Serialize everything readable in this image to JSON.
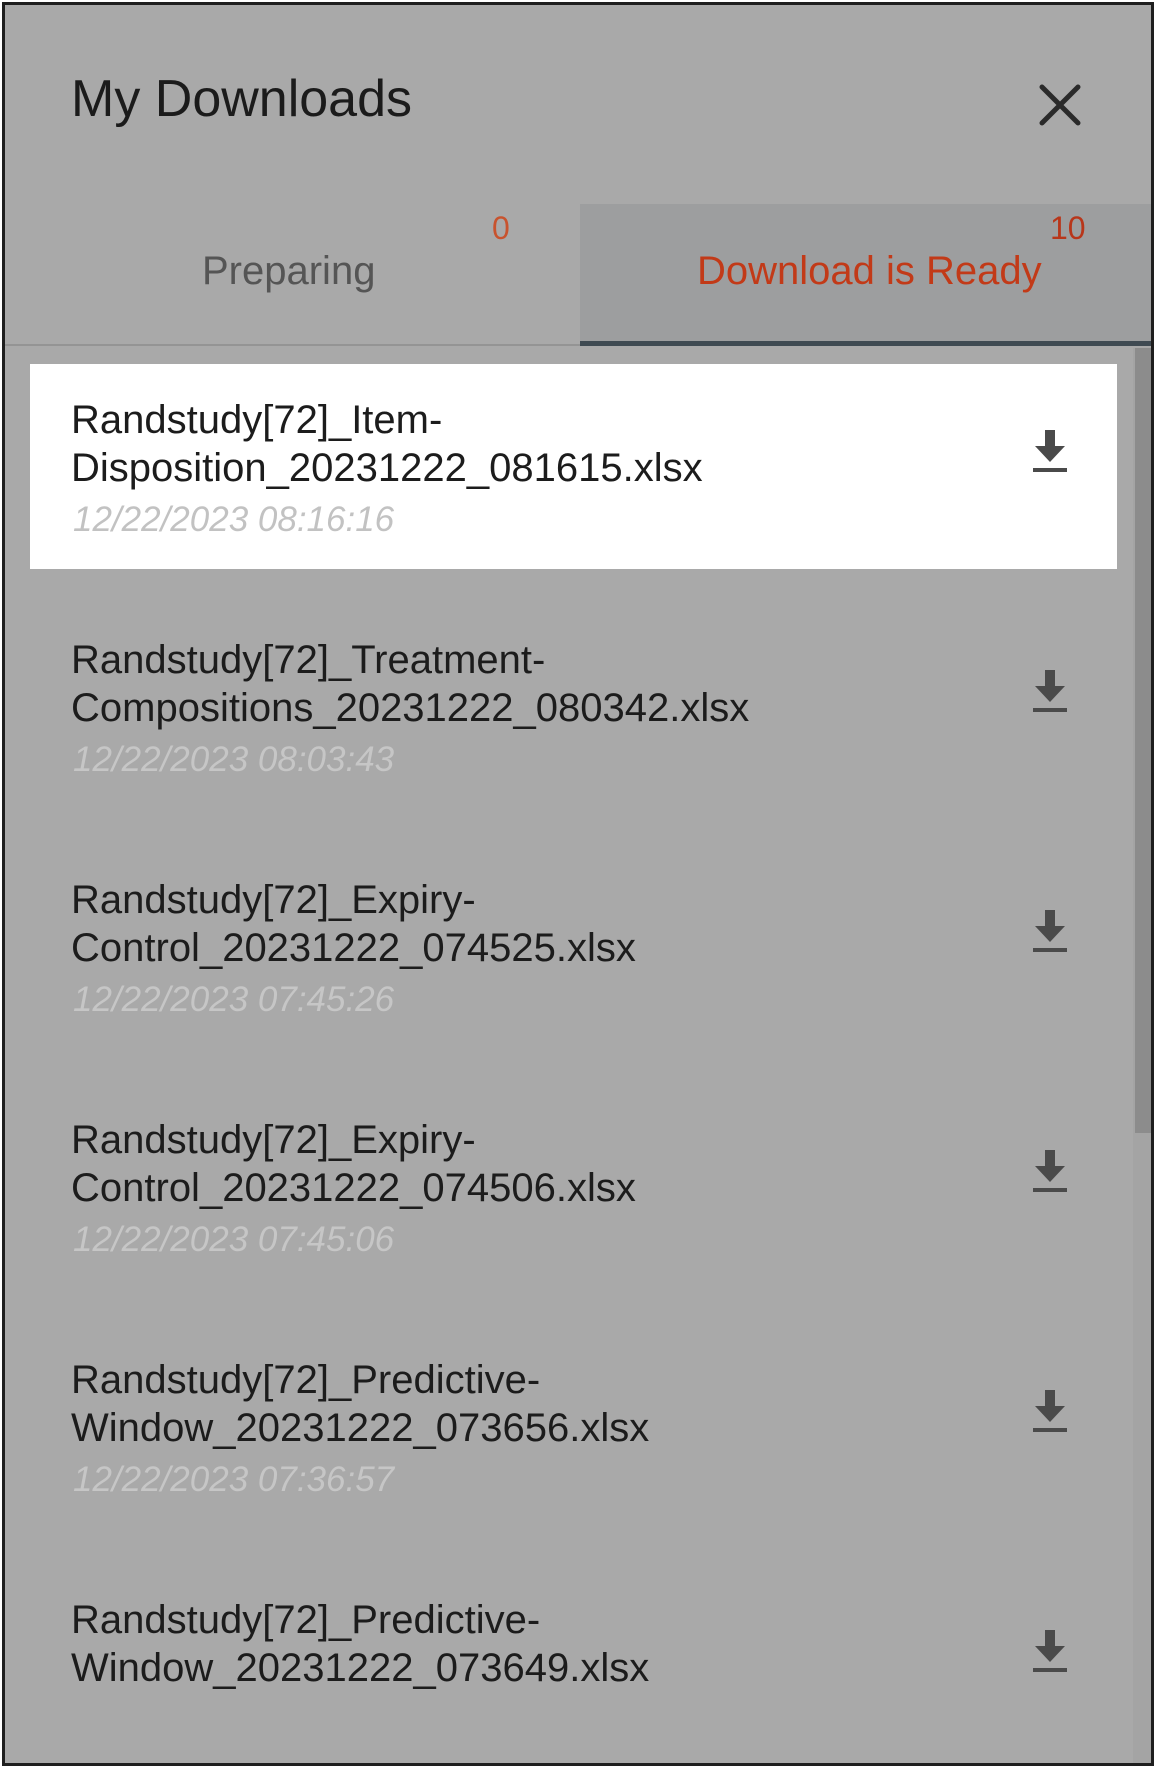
{
  "panel": {
    "title": "My Downloads",
    "close_icon": "close-icon"
  },
  "tabs": [
    {
      "label": "Preparing",
      "count": "0",
      "active": false
    },
    {
      "label": "Download is Ready",
      "count": "10",
      "active": true
    }
  ],
  "colors": {
    "active_tab_text": "#c23a18",
    "count_badge": "#c8532e",
    "overlay_background": "#a9a9a9",
    "selected_item_background": "#ffffff"
  },
  "downloads": [
    {
      "name": "Randstudy[72]_Item-\nDisposition_20231222_081615.xlsx",
      "date": "12/22/2023 08:16:16",
      "icon": "download-icon"
    },
    {
      "name": "Randstudy[72]_Treatment-\nCompositions_20231222_080342.xlsx",
      "date": "12/22/2023 08:03:43",
      "icon": "download-icon"
    },
    {
      "name": "Randstudy[72]_Expiry-\nControl_20231222_074525.xlsx",
      "date": "12/22/2023 07:45:26",
      "icon": "download-icon"
    },
    {
      "name": "Randstudy[72]_Expiry-\nControl_20231222_074506.xlsx",
      "date": "12/22/2023 07:45:06",
      "icon": "download-icon"
    },
    {
      "name": "Randstudy[72]_Predictive-\nWindow_20231222_073656.xlsx",
      "date": "12/22/2023 07:36:57",
      "icon": "download-icon"
    },
    {
      "name": "Randstudy[72]_Predictive-\nWindow_20231222_073649.xlsx",
      "date": "",
      "icon": "download-icon"
    }
  ]
}
